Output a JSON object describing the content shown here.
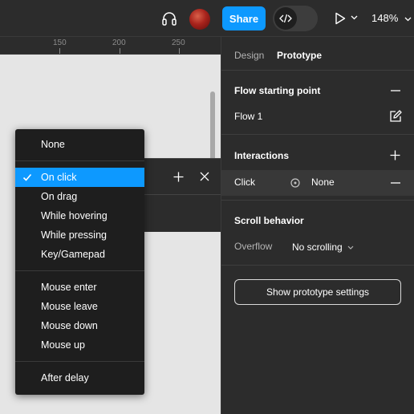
{
  "topbar": {
    "share_label": "Share",
    "zoom_label": "148%"
  },
  "canvas": {
    "ruler_labels": [
      "150",
      "200",
      "250"
    ]
  },
  "panel": {
    "tabs": [
      "Design",
      "Prototype"
    ],
    "active_tab": "Prototype",
    "flow_section_title": "Flow starting point",
    "flow_name": "Flow 1",
    "interactions_title": "Interactions",
    "interaction_trigger": "Click",
    "interaction_action": "None",
    "scroll_title": "Scroll behavior",
    "overflow_label": "Overflow",
    "overflow_value": "No scrolling",
    "settings_button": "Show prototype settings"
  },
  "trigger_menu": {
    "selected": "On click",
    "items": [
      "None",
      "On click",
      "On drag",
      "While hovering",
      "While pressing",
      "Key/Gamepad",
      "Mouse enter",
      "Mouse leave",
      "Mouse down",
      "Mouse up",
      "After delay"
    ]
  },
  "colors": {
    "accent": "#0d99ff",
    "panel_bg": "#2c2c2c",
    "menu_bg": "#1e1e1e",
    "canvas_bg": "#e5e5e5"
  }
}
